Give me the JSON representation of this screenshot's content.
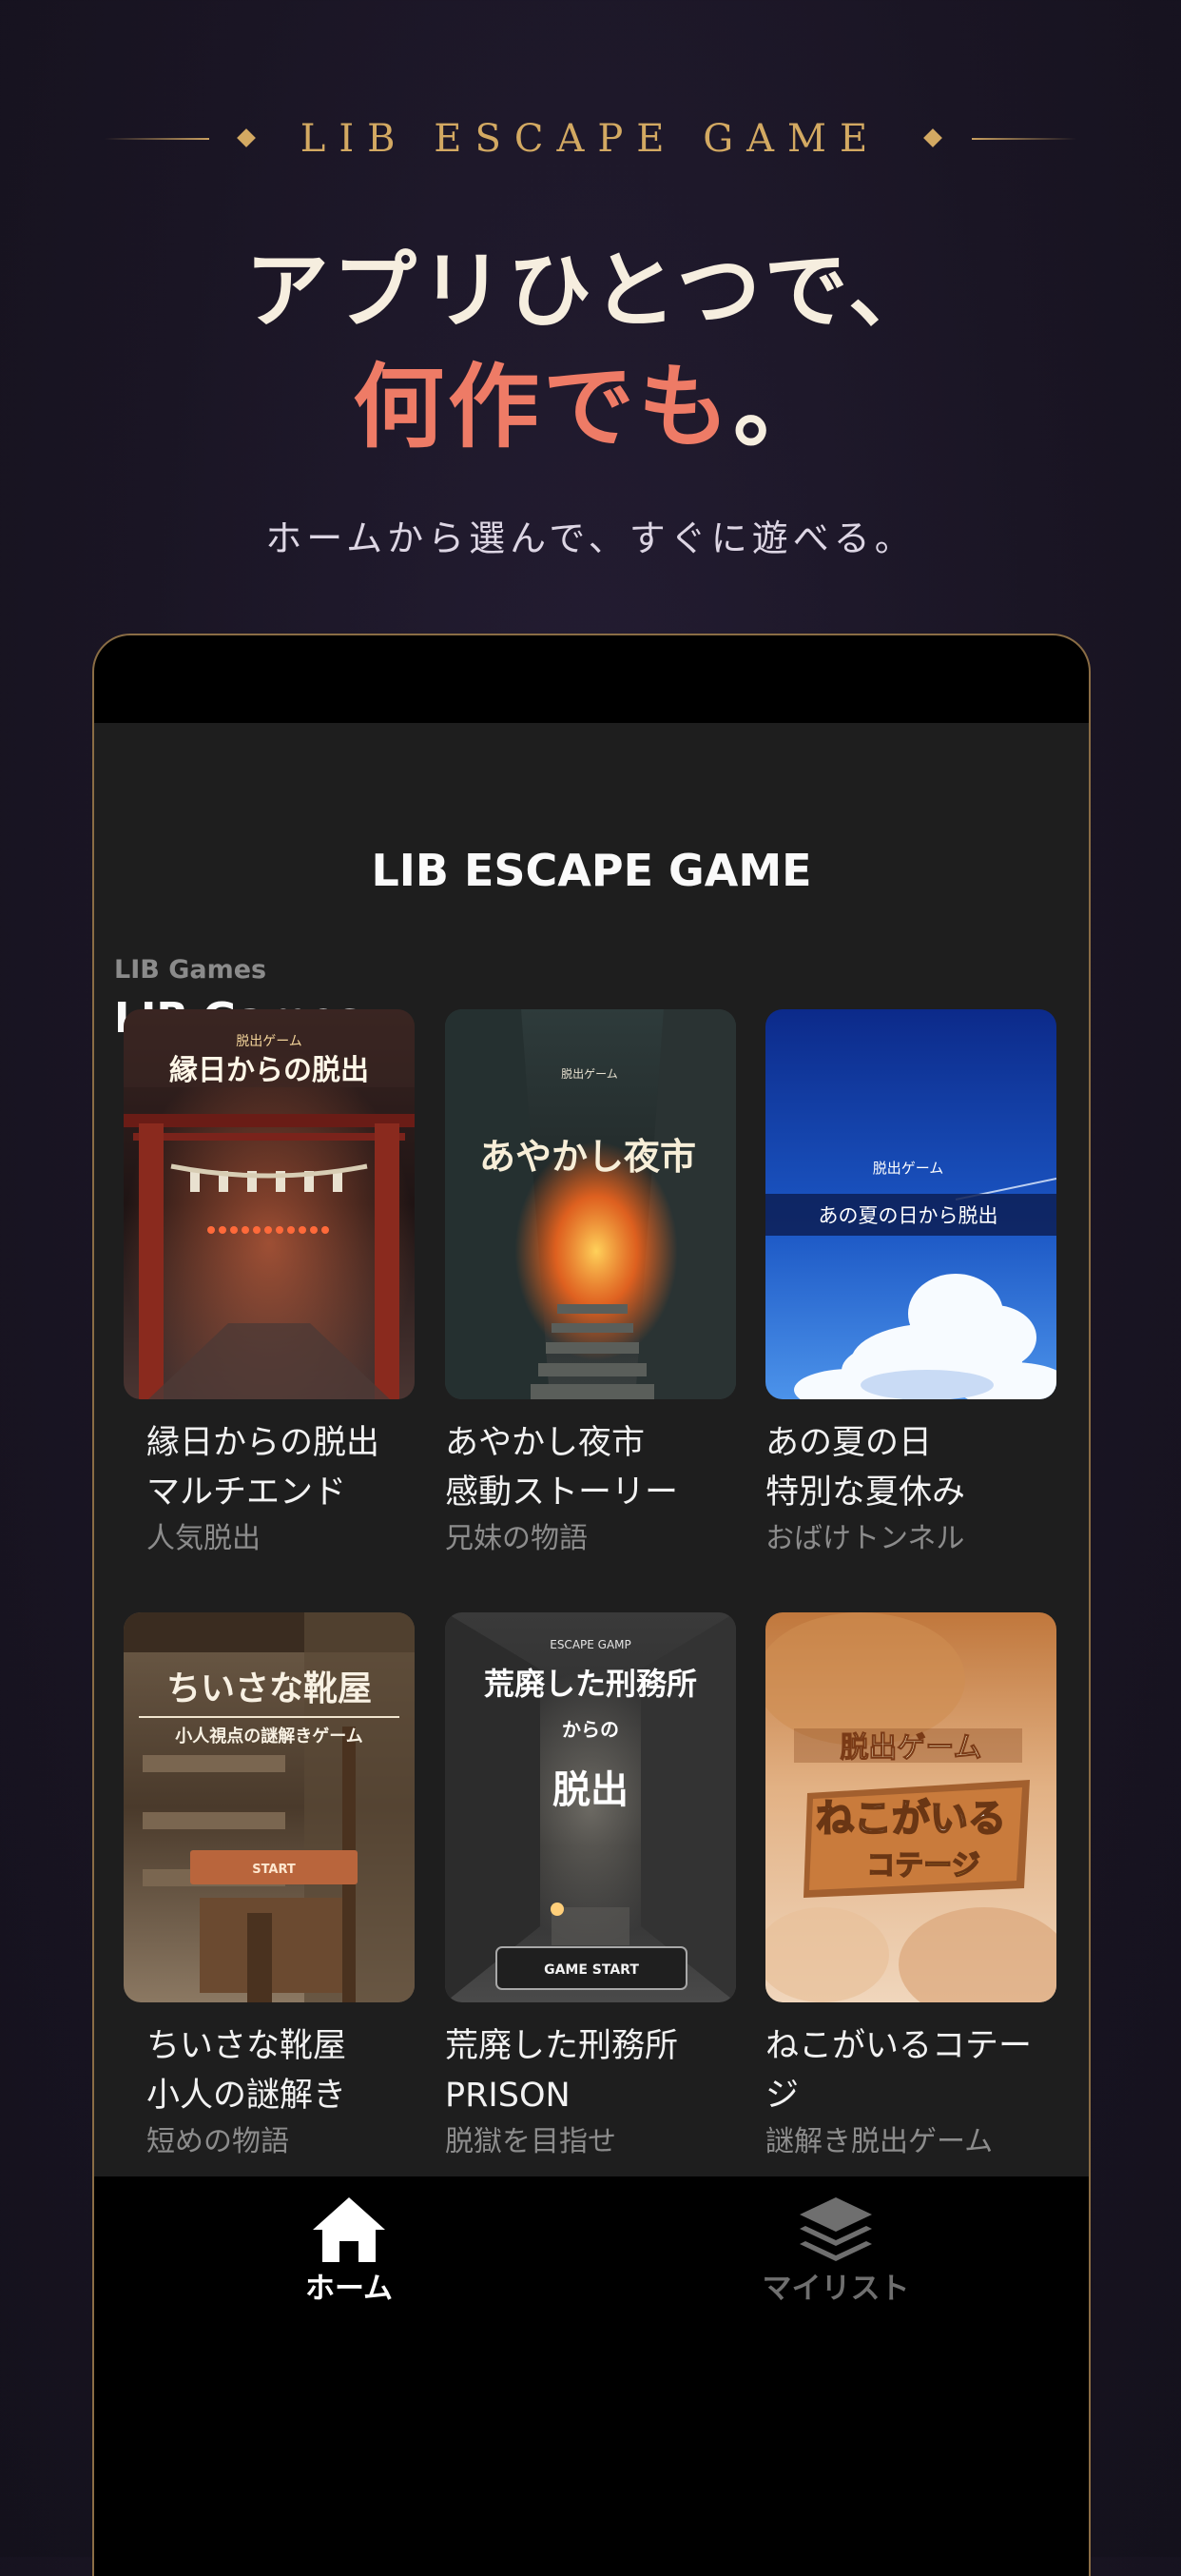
{
  "promo": {
    "brand": "LIB ESCAPE GAME",
    "headline_line1": "アプリひとつで、",
    "headline_accent": "何作でも",
    "headline_end": "。",
    "subline": "ホームから選んで、すぐに遊べる。"
  },
  "app": {
    "title": "LIB ESCAPE GAME",
    "section_kicker": "LIB Games",
    "section_title": "LIB Games"
  },
  "games": [
    {
      "name": "縁日からの脱出\nマルチエンド",
      "tag": "人気脱出",
      "art": {
        "label": "脱出ゲーム",
        "title": "縁日からの脱出"
      }
    },
    {
      "name": "あやかし夜市\n感動ストーリー",
      "tag": "兄妹の物語",
      "art": {
        "label": "脱出ゲーム",
        "title": "あやかし夜市"
      }
    },
    {
      "name": "あの夏の日\n特別な夏休み",
      "tag": "おばけトンネル",
      "art": {
        "label": "脱出ゲーム",
        "title": "あの夏の日から脱出"
      }
    },
    {
      "name": "ちいさな靴屋\n小人の謎解き",
      "tag": "短めの物語",
      "art": {
        "title": "ちいさな靴屋",
        "subtitle": "小人視点の謎解きゲーム",
        "button": "START"
      }
    },
    {
      "name": "荒廃した刑務所\nPRISON",
      "tag": "脱獄を目指せ",
      "art": {
        "label": "ESCAPE GAMP",
        "title": "荒廃した刑務所",
        "mid": "からの",
        "title2": "脱出",
        "button": "GAME START"
      }
    },
    {
      "name": "ねこがいるコテー\nジ",
      "tag": "謎解き脱出ゲーム",
      "art": {
        "label": "脱出ゲーム",
        "title": "ねこがいる",
        "title2": "コテージ"
      }
    }
  ],
  "tabbar": {
    "home_label": "ホーム",
    "mylist_label": "マイリスト",
    "active": "home"
  },
  "colors": {
    "accent": "#ee7b66",
    "gold": "#d3a962",
    "background": "#1a1524",
    "app_surface": "#1e1e1e"
  }
}
